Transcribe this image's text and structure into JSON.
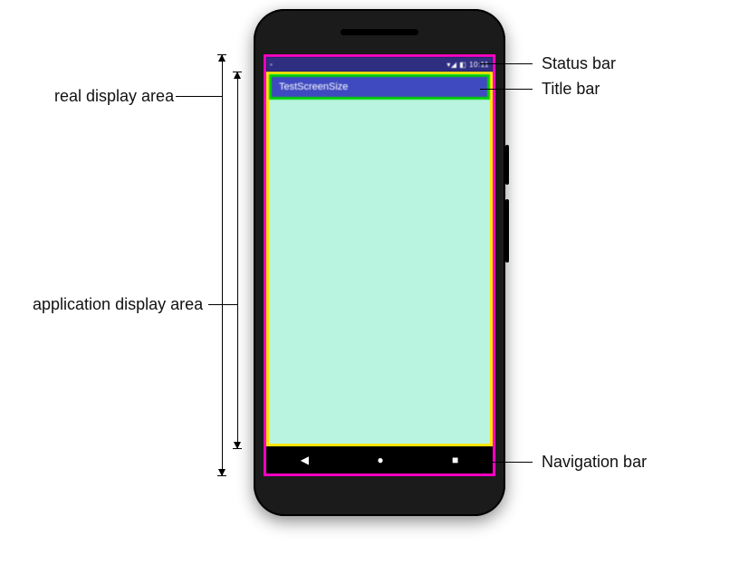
{
  "labels": {
    "real_display_area": "real display area",
    "application_display_area": "application display area",
    "status_bar": "Status bar",
    "title_bar": "Title bar",
    "navigation_bar": "Navigation bar"
  },
  "phone": {
    "status_bar": {
      "time": "10:11",
      "signal_icons": "▾◢ ◧"
    },
    "title_bar": {
      "app_name": "TestScreenSize"
    },
    "nav_bar": {
      "back_glyph": "◀",
      "home_glyph": "●",
      "recent_glyph": "■"
    }
  },
  "colors": {
    "real_display_border": "#ff00c0",
    "application_display_border": "#ffe600",
    "title_bar_border": "#00d000",
    "title_bar_bg": "#3f4ac0",
    "content_bg": "#b8f4e0"
  }
}
